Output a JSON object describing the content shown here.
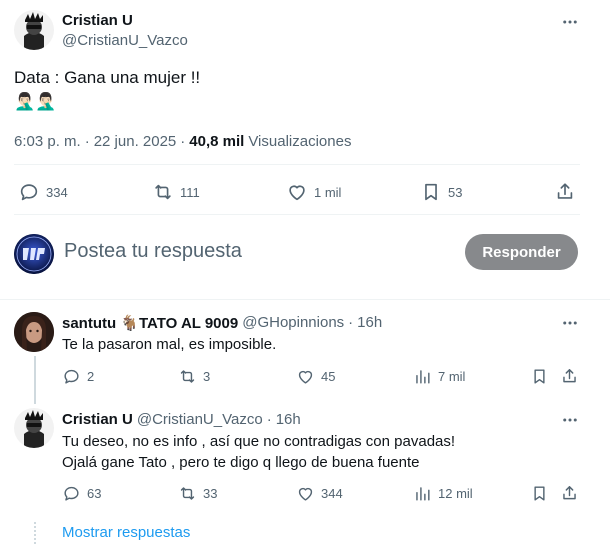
{
  "main_post": {
    "author_name": "Cristian U",
    "author_handle": "@CristianU_Vazco",
    "text_line1": "Data : Gana una mujer !!",
    "emoji_line": "🤦🏻‍♂️🤦🏻‍♂️",
    "time": "6:03 p. m.",
    "date": "22 jun. 2025",
    "separator": "·",
    "views_count": "40,8 mil",
    "views_label": "Visualizaciones",
    "replies": "334",
    "reposts": "111",
    "likes": "1 mil",
    "bookmarks": "53"
  },
  "reply_box": {
    "placeholder": "Postea tu respuesta",
    "button_label": "Responder"
  },
  "replies": [
    {
      "author_name": "santutu 🐐TATO AL 9009",
      "author_handle": "@GHopinnions",
      "separator": "·",
      "time": "16h",
      "text": "Te la pasaron mal, es imposible.",
      "replies": "2",
      "reposts": "3",
      "likes": "45",
      "views": "7 mil"
    },
    {
      "author_name": "Cristian U",
      "author_handle": "@CristianU_Vazco",
      "separator": "·",
      "time": "16h",
      "text_line1": "Tu deseo, no es info , así que no contradigas con pavadas!",
      "text_line2": "Ojalá gane Tato , pero te digo q llego de buena fuente",
      "replies": "63",
      "reposts": "33",
      "likes": "344",
      "views": "12 mil"
    }
  ],
  "show_replies_label": "Mostrar respuestas",
  "colors": {
    "accent": "#1d9bf0",
    "button_disabled": "#87898c",
    "muted_text": "#536471",
    "divider": "#eff3f4"
  }
}
